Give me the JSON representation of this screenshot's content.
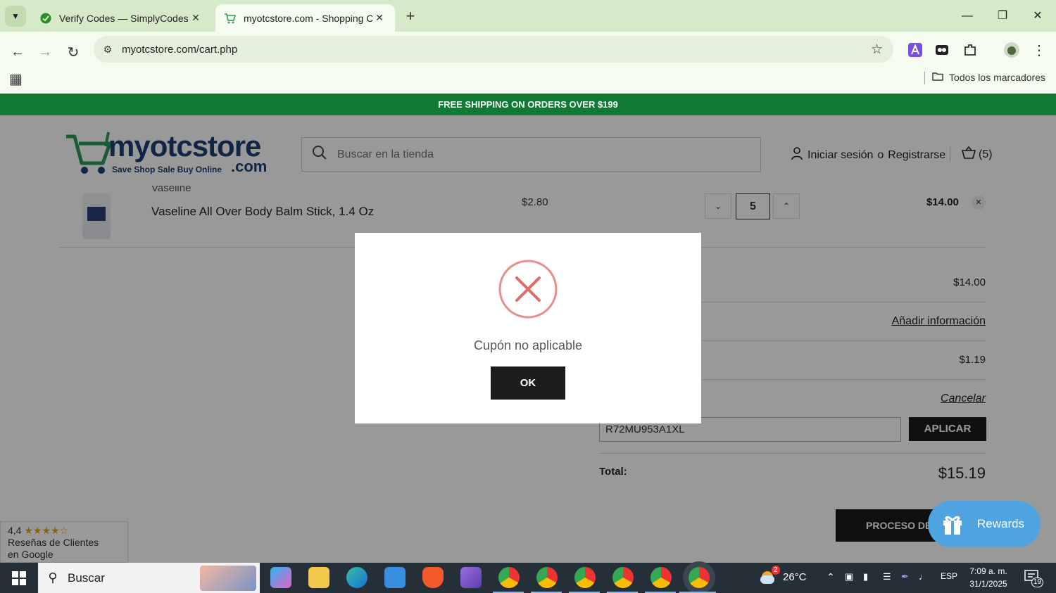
{
  "browser": {
    "tabs": [
      {
        "title": "Verify Codes — SimplyCodes",
        "active": false
      },
      {
        "title": "myotcstore.com - Shopping Car",
        "active": true
      }
    ],
    "url": "myotcstore.com/cart.php",
    "bookmarks_label": "Todos los marcadores"
  },
  "promo_banner": "FREE SHIPPING ON ORDERS OVER $199",
  "header": {
    "logo_brand": "myotcstore",
    "logo_tagline": "Save Shop Sale Buy Online",
    "logo_tld": ".com",
    "search_placeholder": "Buscar en la tienda",
    "login_label": "Iniciar sesión",
    "or_label": "o",
    "register_label": "Registrarse",
    "cart_count": "(5)"
  },
  "cart_item": {
    "brand": "Vaseline",
    "name": "Vaseline All Over Body Balm Stick, 1.4 Oz",
    "price": "$2.80",
    "quantity": "5",
    "total": "$14.00"
  },
  "summary": {
    "subtotal": "$14.00",
    "shipping_link": "Añadir información",
    "tax": "$1.19",
    "coupon_cancel": "Cancelar",
    "coupon_code": "R72MU953A1XL",
    "apply_label": "APLICAR",
    "total_label": "Total:",
    "total_value": "$15.19",
    "checkout_label": "PROCESO DE PAGO"
  },
  "google_reviews": {
    "rating": "4,4",
    "line1": "Reseñas de Clientes",
    "line2": "en Google"
  },
  "rewards_label": "Rewards",
  "modal": {
    "message": "Cupón no aplicable",
    "ok_label": "OK"
  },
  "taskbar": {
    "search_label": "Buscar",
    "weather_temp": "26°C",
    "weather_badge": "2",
    "language": "ESP",
    "time": "7:09 a. m.",
    "date": "31/1/2025",
    "notifications": "19"
  },
  "colors": {
    "promo_green": "#107a35",
    "error_red": "#e06c66",
    "rewards_blue": "#4ea3e0",
    "logo_green": "#2e9a5a",
    "logo_blue": "#1d3e72"
  }
}
